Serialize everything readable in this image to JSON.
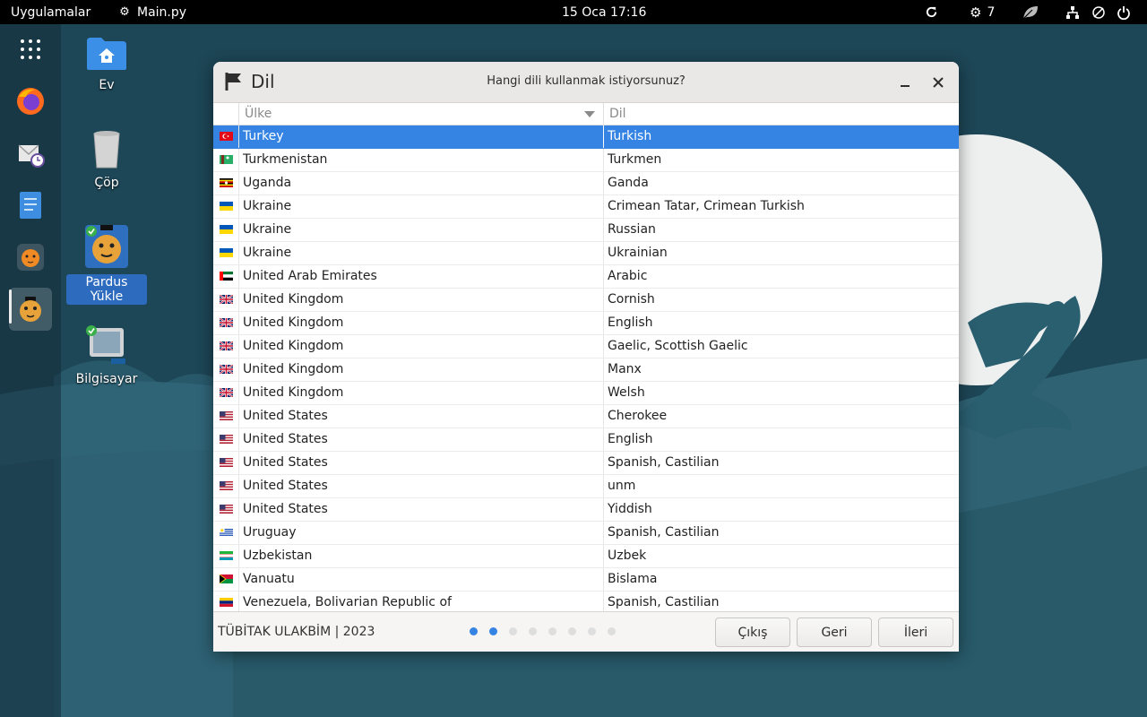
{
  "topbar": {
    "apps_label": "Uygulamalar",
    "active_app": "Main.py",
    "clock": "15 Oca  17:16",
    "updates_count": "7"
  },
  "desktop": {
    "icons": [
      {
        "label": "Ev"
      },
      {
        "label": "Çöp"
      },
      {
        "label": "Pardus Yükle"
      },
      {
        "label": "Bilgisayar"
      }
    ]
  },
  "window": {
    "title": "Dil",
    "subtitle": "Hangi dili kullanmak istiyorsunuz?",
    "columns": {
      "country": "Ülke",
      "language": "Dil"
    },
    "rows": [
      {
        "country": "Turkey",
        "language": "Turkish",
        "flag": "tr"
      },
      {
        "country": "Turkmenistan",
        "language": "Turkmen",
        "flag": "tm"
      },
      {
        "country": "Uganda",
        "language": "Ganda",
        "flag": "ug"
      },
      {
        "country": "Ukraine",
        "language": "Crimean Tatar, Crimean Turkish",
        "flag": "ua"
      },
      {
        "country": "Ukraine",
        "language": "Russian",
        "flag": "ua"
      },
      {
        "country": "Ukraine",
        "language": "Ukrainian",
        "flag": "ua"
      },
      {
        "country": "United Arab Emirates",
        "language": "Arabic",
        "flag": "ae"
      },
      {
        "country": "United Kingdom",
        "language": "Cornish",
        "flag": "gb"
      },
      {
        "country": "United Kingdom",
        "language": "English",
        "flag": "gb"
      },
      {
        "country": "United Kingdom",
        "language": "Gaelic, Scottish Gaelic",
        "flag": "gb"
      },
      {
        "country": "United Kingdom",
        "language": "Manx",
        "flag": "gb"
      },
      {
        "country": "United Kingdom",
        "language": "Welsh",
        "flag": "gb"
      },
      {
        "country": "United States",
        "language": "Cherokee",
        "flag": "us"
      },
      {
        "country": "United States",
        "language": "English",
        "flag": "us"
      },
      {
        "country": "United States",
        "language": "Spanish, Castilian",
        "flag": "us"
      },
      {
        "country": "United States",
        "language": "unm",
        "flag": "us"
      },
      {
        "country": "United States",
        "language": "Yiddish",
        "flag": "us"
      },
      {
        "country": "Uruguay",
        "language": "Spanish, Castilian",
        "flag": "uy"
      },
      {
        "country": "Uzbekistan",
        "language": "Uzbek",
        "flag": "uz"
      },
      {
        "country": "Vanuatu",
        "language": "Bislama",
        "flag": "vu"
      },
      {
        "country": "Venezuela, Bolivarian Republic of",
        "language": "Spanish, Castilian",
        "flag": "ve"
      }
    ],
    "selected_index": 0,
    "footer": {
      "copyright": "TÜBİTAK ULAKBİM | 2023",
      "steps_total": 8,
      "steps_done": 2,
      "exit_label": "Çıkış",
      "back_label": "Geri",
      "next_label": "İleri"
    }
  },
  "colors": {
    "accent": "#3584e4",
    "topbar": "#000000",
    "wallpaper": "#1f4a5a"
  }
}
